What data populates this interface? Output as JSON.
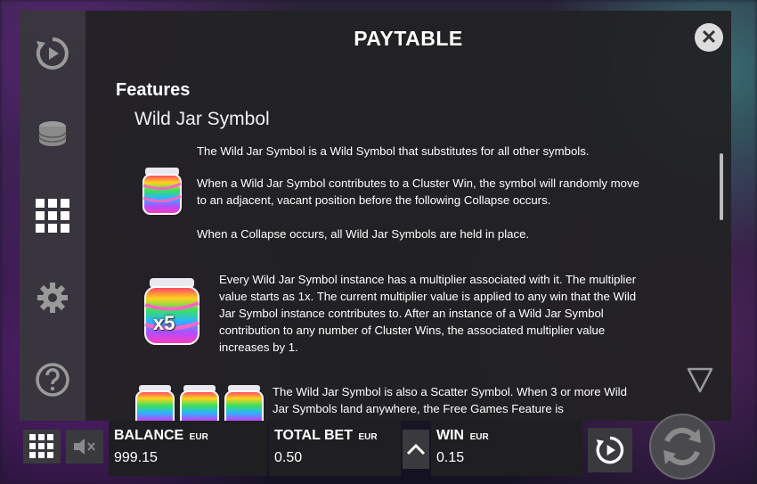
{
  "paytable": {
    "title": "PAYTABLE",
    "section_title": "Features",
    "subsection_title": "Wild Jar Symbol",
    "paragraphs": {
      "p1": "The Wild Jar Symbol is a Wild Symbol that substitutes for all other symbols.",
      "p2": "When a Wild Jar Symbol contributes to a Cluster Win, the symbol will randomly move to an adjacent, vacant position before the following Collapse occurs.",
      "p3": "When a Collapse occurs, all Wild Jar Symbols are held in place.",
      "p4": "Every Wild Jar Symbol instance has a multiplier associated with it. The multiplier value starts as 1x. The current multiplier value is applied to any win that the Wild Jar Symbol instance contributes to. After an instance of a Wild Jar Symbol contribution to any number of Cluster Wins, the associated multiplier value increases by 1.",
      "p5": "The Wild Jar Symbol is also a Scatter Symbol. When 3 or more Wild Jar Symbols land anywhere, the Free Games Feature is"
    },
    "jar_multiplier_label": "x5"
  },
  "sidebar": {
    "items": [
      {
        "icon": "autoplay-icon"
      },
      {
        "icon": "coins-icon"
      },
      {
        "icon": "paytable-grid-icon"
      },
      {
        "icon": "settings-gear-icon"
      },
      {
        "icon": "help-icon"
      }
    ]
  },
  "bottom_bar": {
    "balance": {
      "label": "BALANCE",
      "currency": "EUR",
      "value": "999.15"
    },
    "total_bet": {
      "label": "TOTAL BET",
      "currency": "EUR",
      "value": "0.50"
    },
    "win": {
      "label": "WIN",
      "currency": "EUR",
      "value": "0.15"
    }
  },
  "colors": {
    "panel_bg": "#222224",
    "sidebar_bg": "#37373c",
    "text": "#ffffff",
    "close_button_bg": "#dddddd"
  }
}
